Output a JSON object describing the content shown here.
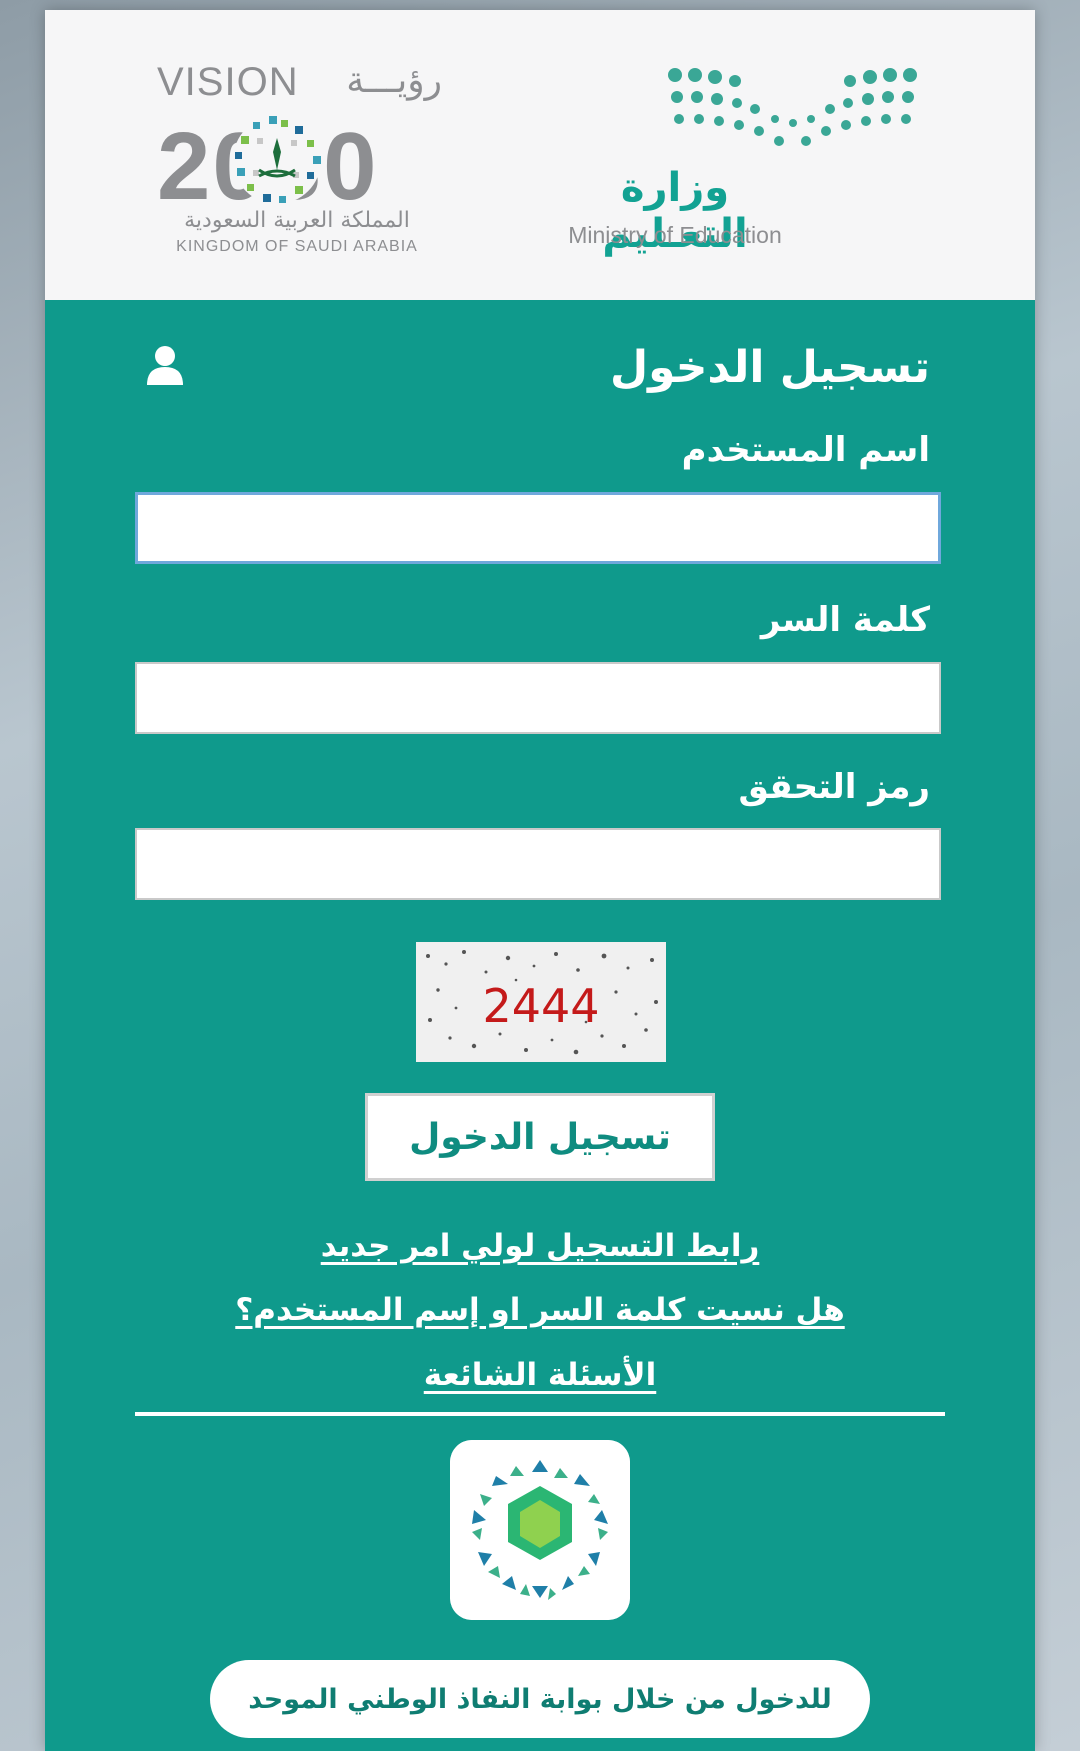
{
  "header": {
    "vision_logo": {
      "title": "VISION",
      "title_ar": "رؤيـــة",
      "year": "2030",
      "country_ar": "المملكة العربية السعودية",
      "country_en": "KINGDOM OF SAUDI ARABIA"
    },
    "ministry_logo": {
      "name_ar": "وزارة التعـليم",
      "name_en": "Ministry of Education"
    }
  },
  "form": {
    "title": "تسجيل الدخول",
    "user_icon": "user-icon",
    "username_label": "اسم المستخدم",
    "username_value": "",
    "password_label": "كلمة السر",
    "password_value": "",
    "captcha_label": "رمز التحقق",
    "captcha_value": "",
    "captcha_code": "2444",
    "submit_label": "تسجيل الدخول"
  },
  "links": {
    "parent_registration": "رابط التسجيل لولي امر جديد",
    "forgot": "هل نسيت كلمة السر او إسم المستخدم؟",
    "faq": "الأسئلة الشائعة"
  },
  "nafath": {
    "logo_icon": "nafath-logo-icon",
    "button_label": "للدخول من خلال بوابة النفاذ الوطني الموحد"
  },
  "colors": {
    "primary": "#0f9a8c",
    "header_bg": "#f6f6f7",
    "logo_gray": "#8d8e91",
    "captcha_text": "#c41a1a"
  }
}
